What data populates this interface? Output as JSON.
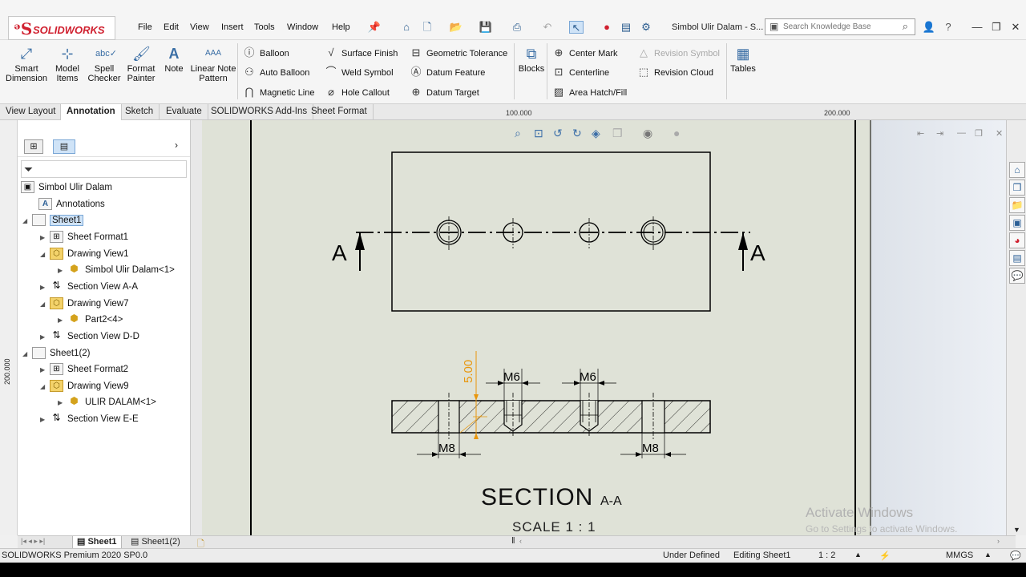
{
  "app": {
    "brand": "SOLIDWORKS",
    "document_title": "Simbol Ulir Dalam - S..."
  },
  "menu": [
    "File",
    "Edit",
    "View",
    "Insert",
    "Tools",
    "Window",
    "Help"
  ],
  "search": {
    "placeholder": "Search Knowledge Base"
  },
  "ribbon": {
    "big": [
      {
        "label": "Smart Dimension",
        "icon": "smart-dimension-icon"
      },
      {
        "label": "Model Items",
        "icon": "model-items-icon"
      },
      {
        "label": "Spell Checker",
        "icon": "spell-checker-icon"
      },
      {
        "label": "Format Painter",
        "icon": "format-painter-icon"
      },
      {
        "label": "Note",
        "icon": "note-icon"
      },
      {
        "label": "Linear Note Pattern",
        "icon": "linear-note-pattern-icon"
      }
    ],
    "col1": [
      "Balloon",
      "Auto Balloon",
      "Magnetic Line"
    ],
    "col2": [
      "Surface Finish",
      "Weld Symbol",
      "Hole Callout"
    ],
    "col3": [
      "Geometric Tolerance",
      "Datum Feature",
      "Datum Target"
    ],
    "blocks": "Blocks",
    "col4": [
      "Center Mark",
      "Centerline",
      "Area Hatch/Fill"
    ],
    "col5": [
      "Revision Symbol",
      "Revision Cloud"
    ],
    "tables": "Tables"
  },
  "tabs": [
    "View Layout",
    "Annotation",
    "Sketch",
    "Evaluate",
    "SOLIDWORKS Add-Ins",
    "Sheet Format"
  ],
  "active_tab": "Annotation",
  "ruler": {
    "h1": "100.000",
    "h2": "200.000",
    "v1": "200.000"
  },
  "tree": [
    {
      "label": "Simbol Ulir Dalam"
    },
    {
      "label": "Annotations"
    },
    {
      "label": "Sheet1"
    },
    {
      "label": "Sheet Format1"
    },
    {
      "label": "Drawing View1"
    },
    {
      "label": "Simbol Ulir Dalam<1>"
    },
    {
      "label": "Section View A-A"
    },
    {
      "label": "Drawing View7"
    },
    {
      "label": "Part2<4>"
    },
    {
      "label": "Section View D-D"
    },
    {
      "label": "Sheet1(2)"
    },
    {
      "label": "Sheet Format2"
    },
    {
      "label": "Drawing View9"
    },
    {
      "label": "ULIR DALAM<1>"
    },
    {
      "label": "Section View E-E"
    }
  ],
  "drawing": {
    "section_letter": "A",
    "dims": {
      "m6": "M6",
      "m8": "M8",
      "height": "5.00"
    },
    "section_title": "SECTION",
    "section_id": "A-A",
    "scale": "SCALE 1 : 1"
  },
  "watermark": {
    "line1": "Activate Windows",
    "line2": "Go to Settings to activate Windows."
  },
  "sheet_tabs": [
    "Sheet1",
    "Sheet1(2)"
  ],
  "status": {
    "product": "SOLIDWORKS Premium 2020 SP0.0",
    "state": "Under Defined",
    "editing": "Editing Sheet1",
    "scale": "1 : 2",
    "units": "MMGS"
  },
  "colors": {
    "accent": "#d0202f",
    "dimension": "#e8960c",
    "drawing_bg": "#dfe2d7"
  }
}
